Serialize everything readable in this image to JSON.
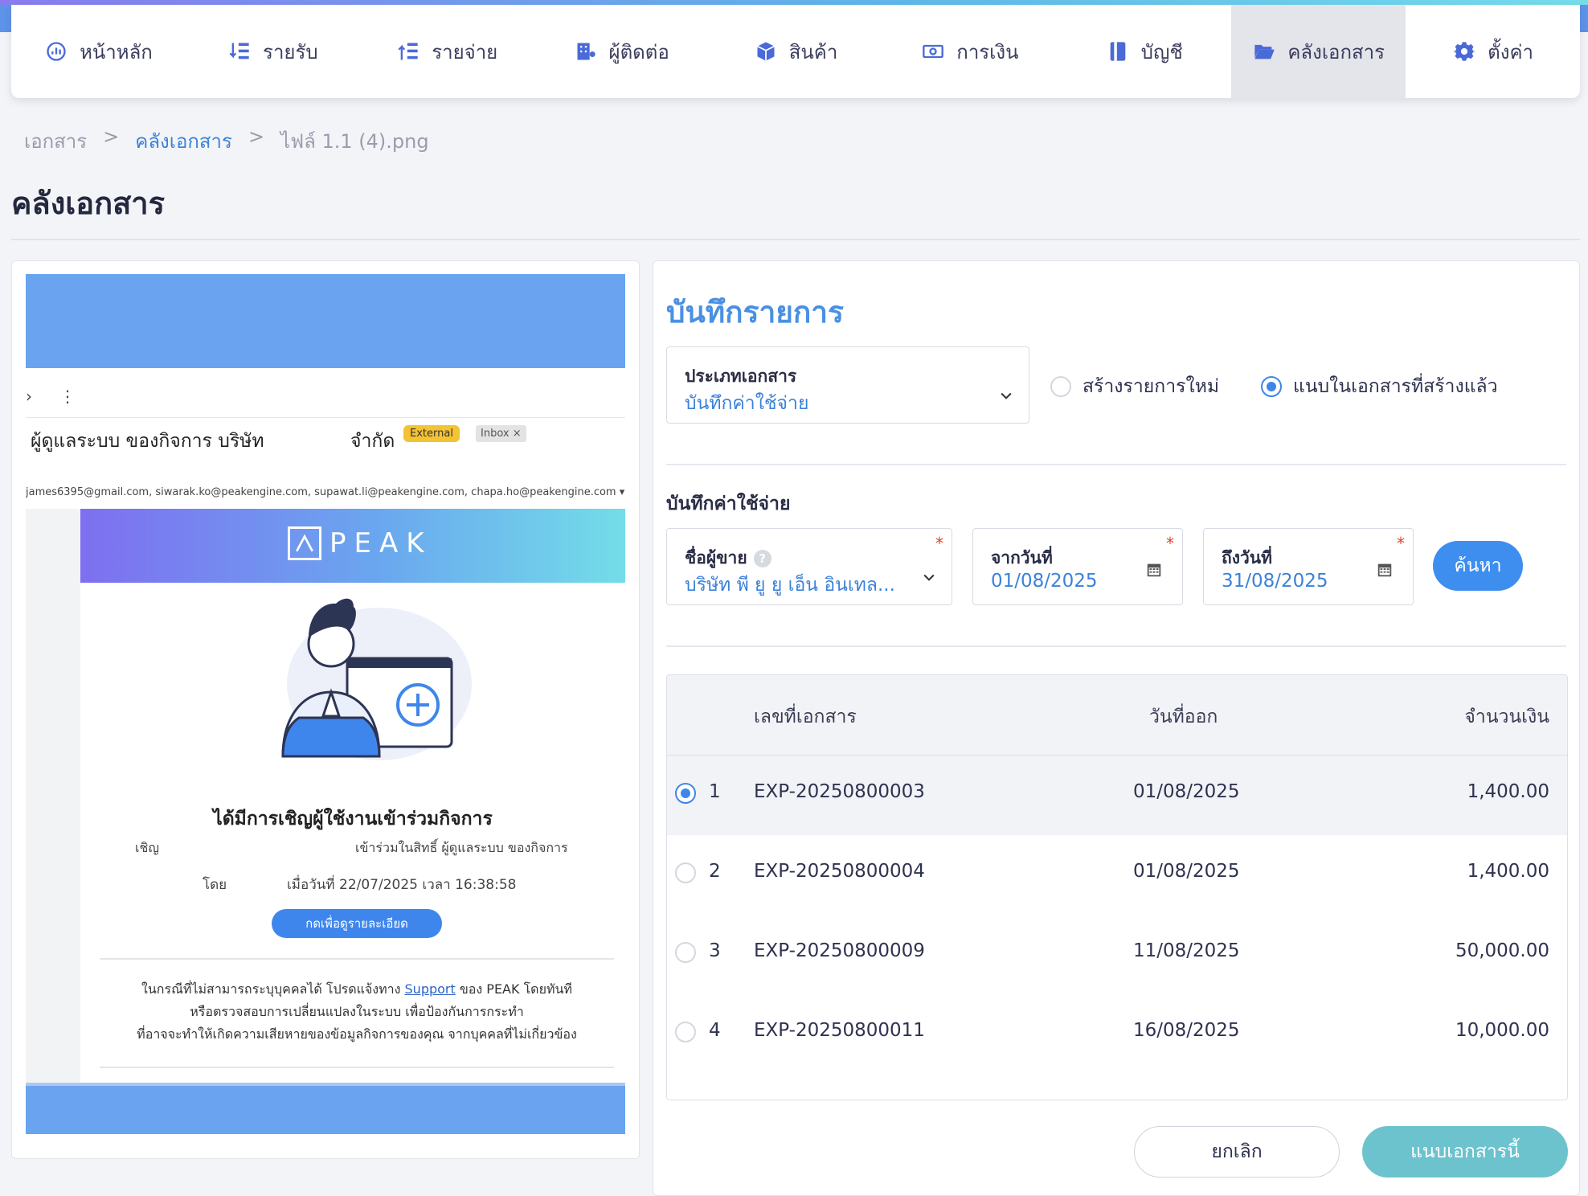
{
  "nav": {
    "items": [
      {
        "label": "หน้าหลัก",
        "icon": "dashboard-icon"
      },
      {
        "label": "รายรับ",
        "icon": "income-icon"
      },
      {
        "label": "รายจ่าย",
        "icon": "expense-icon"
      },
      {
        "label": "ผู้ติดต่อ",
        "icon": "contacts-icon"
      },
      {
        "label": "สินค้า",
        "icon": "box-icon"
      },
      {
        "label": "การเงิน",
        "icon": "money-icon"
      },
      {
        "label": "บัญชี",
        "icon": "ledger-icon"
      },
      {
        "label": "คลังเอกสาร",
        "icon": "folder-icon",
        "active": true
      },
      {
        "label": "ตั้งค่า",
        "icon": "gear-icon"
      }
    ]
  },
  "breadcrumb": {
    "root": "เอกสาร",
    "sep1": ">",
    "link": "คลังเอกสาร",
    "sep2": ">",
    "current": "ไฟล์ 1.1 (4).png"
  },
  "page": {
    "title": "คลังเอกสาร"
  },
  "preview": {
    "subject_left": "ผู้ดูแลระบบ ของกิจการ บริษัท",
    "subject_right": "จำกัด",
    "badge_external": "External",
    "badge_inbox": "Inbox ×",
    "recipients": "james6395@gmail.com, siwarak.ko@peakengine.com, supawat.li@peakengine.com, chapa.ho@peakengine.com ▾",
    "logo_text": "PEAK",
    "heading": "ได้มีการเชิญผู้ใช้งานเข้าร่วมกิจการ",
    "invite_label": "เชิญ",
    "invite_value": "เข้าร่วมในสิทธิ์ ผู้ดูแลระบบ ของกิจการ",
    "by_label": "โดย",
    "by_value": "เมื่อวันที่ 22/07/2025 เวลา 16:38:58",
    "detail_button": "กดเพื่อดูรายละเอียด",
    "notice_part1": "ในกรณีที่ไม่สามารถระบุบุคคลได้ โปรดแจ้งทาง ",
    "notice_link": "Support",
    "notice_part2": " ของ PEAK โดยทันที",
    "notice_line2": "หรือตรวจสอบการเปลี่ยนแปลงในระบบ เพื่อป้องกันการกระทำ",
    "notice_line3": "ที่อาจจะทำให้เกิดความเสียหายของข้อมูลกิจการของคุณ จากบุคคลที่ไม่เกี่ยวข้อง"
  },
  "form": {
    "title": "บันทึกรายการ",
    "doc_type_label": "ประเภทเอกสาร",
    "doc_type_value": "บันทึกค่าใช้จ่าย",
    "radio_new": "สร้างรายการใหม่",
    "radio_attach": "แนบในเอกสารที่สร้างแล้ว",
    "section_label": "บันทึกค่าใช้จ่าย",
    "vendor_label": "ชื่อผู้ขาย",
    "vendor_value": "บริษัท พี ยู ยู เอ็น อินเทล...",
    "from_label": "จากวันที่",
    "from_value": "01/08/2025",
    "to_label": "ถึงวันที่",
    "to_value": "31/08/2025",
    "search_button": "ค้นหา",
    "required_mark": "*",
    "help_mark": "?"
  },
  "table": {
    "headers": {
      "doc_no": "เลขที่เอกสาร",
      "date": "วันที่ออก",
      "amount": "จำนวนเงิน"
    },
    "rows": [
      {
        "n": "1",
        "doc_no": "EXP-20250800003",
        "date": "01/08/2025",
        "amount": "1,400.00",
        "selected": true
      },
      {
        "n": "2",
        "doc_no": "EXP-20250800004",
        "date": "01/08/2025",
        "amount": "1,400.00"
      },
      {
        "n": "3",
        "doc_no": "EXP-20250800009",
        "date": "11/08/2025",
        "amount": "50,000.00"
      },
      {
        "n": "4",
        "doc_no": "EXP-20250800011",
        "date": "16/08/2025",
        "amount": "10,000.00"
      }
    ]
  },
  "actions": {
    "cancel": "ยกเลิก",
    "attach": "แนบเอกสารนี้"
  },
  "colors": {
    "accent": "#3e8ef0",
    "attach_button": "#6cc3cd",
    "title_blue": "#4a90e2"
  }
}
